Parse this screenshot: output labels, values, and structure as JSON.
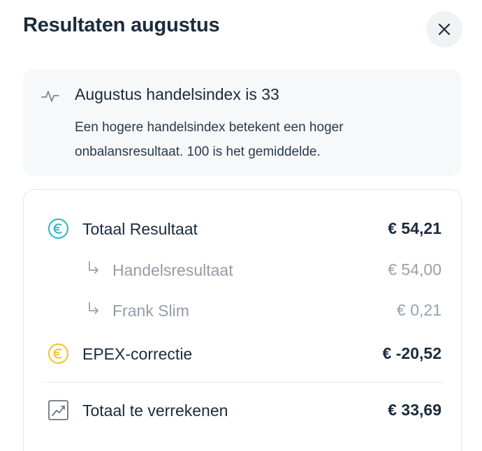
{
  "dialog": {
    "title": "Resultaten augustus",
    "close_icon": "close-icon"
  },
  "info": {
    "icon": "activity-pulse-icon",
    "heading": "Augustus handelsindex is 33",
    "text": "Een hogere handelsindex betekent een hoger onbalansresultaat. 100 is het gemiddelde."
  },
  "results": {
    "total": {
      "icon": "euro-circle-icon",
      "icon_color": "#2bb3c9",
      "label": "Totaal Resultaat",
      "amount": "€ 54,21"
    },
    "sub_items": [
      {
        "icon": "arrow-down-right-icon",
        "label": "Handelsresultaat",
        "amount": "€ 54,00"
      },
      {
        "icon": "arrow-down-right-icon",
        "label": "Frank Slim",
        "amount": "€ 0,21"
      }
    ],
    "epex": {
      "icon": "euro-circle-icon",
      "icon_color": "#f2c12e",
      "label": "EPEX-correctie",
      "amount": "€ -20,52"
    },
    "settle": {
      "icon": "trend-chart-icon",
      "label": "Totaal te verrekenen",
      "amount": "€ 33,69"
    }
  },
  "colors": {
    "text_primary": "#1b2b3e",
    "text_muted": "#949ca6",
    "card_background": "#f6f8fa"
  }
}
